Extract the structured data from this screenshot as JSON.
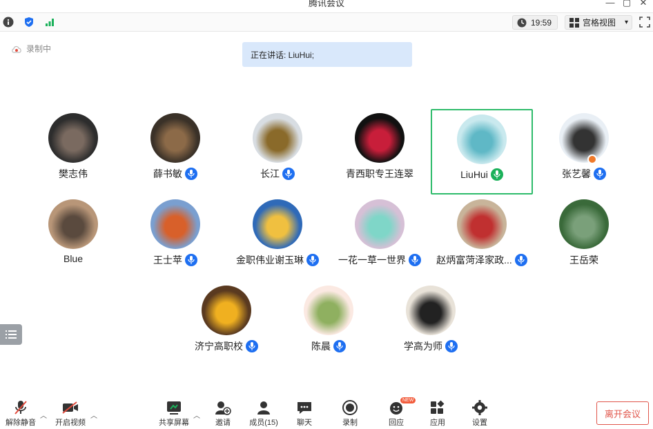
{
  "window": {
    "title": "腾讯会议",
    "controls": [
      "—",
      "▢",
      "✕"
    ]
  },
  "toolbar": {
    "icons": [
      "info-icon",
      "shield-icon",
      "signal-icon"
    ],
    "time": "19:59",
    "view_label": "宫格视图",
    "view_caret": "▾"
  },
  "recording": {
    "label": "录制中"
  },
  "speaker_banner": "正在讲话: LiuHui;",
  "participants": [
    {
      "name": "樊志伟",
      "mic": false,
      "colors": [
        "#2d2d2d",
        "#7a6a60"
      ]
    },
    {
      "name": "薛书敏",
      "mic": true,
      "colors": [
        "#3a3128",
        "#8c6a48"
      ]
    },
    {
      "name": "长江",
      "mic": true,
      "colors": [
        "#d8dde2",
        "#8a6a2a"
      ]
    },
    {
      "name": "青西职专王连翠",
      "mic": false,
      "colors": [
        "#111111",
        "#c81e3a"
      ]
    },
    {
      "name": "LiuHui",
      "mic": true,
      "active": true,
      "colors": [
        "#c9e9ee",
        "#5fb8c6"
      ]
    },
    {
      "name": "张艺馨",
      "mic": true,
      "host": true,
      "colors": [
        "#e9eff5",
        "#333333"
      ]
    },
    {
      "name": "Blue",
      "mic": false,
      "colors": [
        "#b89678",
        "#5a4a3e"
      ]
    },
    {
      "name": "王士苹",
      "mic": true,
      "colors": [
        "#7a9fd0",
        "#d8602a"
      ]
    },
    {
      "name": "金职伟业谢玉琳",
      "mic": true,
      "colors": [
        "#2f6ab8",
        "#f0c040"
      ]
    },
    {
      "name": "一花一草一世界",
      "mic": true,
      "colors": [
        "#d6c0d6",
        "#7fd6c8"
      ]
    },
    {
      "name": "赵炳富菏泽家政...",
      "mic": true,
      "colors": [
        "#c8b49a",
        "#c03030"
      ]
    },
    {
      "name": "王岳荣",
      "mic": false,
      "colors": [
        "#3a6a3a",
        "#7aa07a"
      ]
    },
    {
      "name": "济宁高职校",
      "mic": true,
      "colors": [
        "#5a3a20",
        "#f0b020"
      ]
    },
    {
      "name": "陈晨",
      "mic": true,
      "colors": [
        "#fbe9e2",
        "#8fb060"
      ]
    },
    {
      "name": "学高为师",
      "mic": true,
      "colors": [
        "#e8e2d8",
        "#222222"
      ]
    }
  ],
  "bottom": {
    "mute_label": "解除静音",
    "video_label": "开启视频",
    "share_label": "共享屏幕",
    "invite_label": "邀请",
    "members_label": "成员(15)",
    "chat_label": "聊天",
    "record_label": "录制",
    "react_label": "回应",
    "react_badge": "NEW",
    "apps_label": "应用",
    "settings_label": "设置",
    "leave_label": "离开会议"
  }
}
